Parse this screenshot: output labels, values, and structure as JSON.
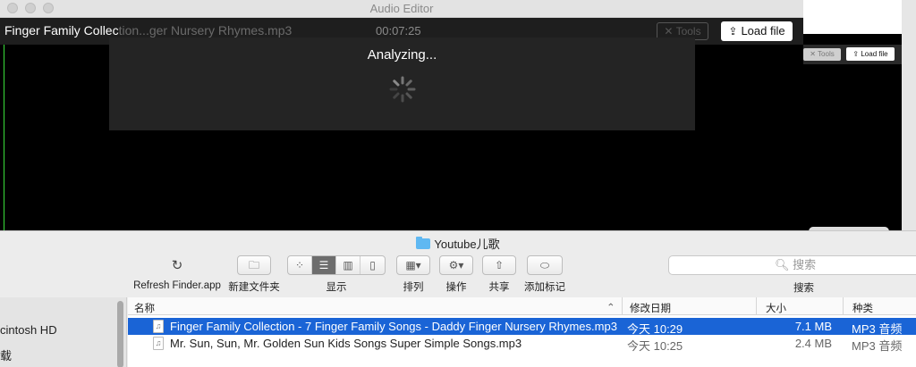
{
  "editor": {
    "window_title": "Audio Editor",
    "file_name_visible": "Finger Family Collec",
    "file_name_faded": "tion...ger Nursery Rhymes.mp3",
    "time": "00:07:25",
    "tools_label": "Tools",
    "load_label": "Load file",
    "analyzing_text": "Analyzing...",
    "playhead_color": "#3adf3a"
  },
  "back_window": {
    "tools_label": "Tools",
    "load_label": "Load file"
  },
  "finder": {
    "title": "Youtube儿歌",
    "toolbar": {
      "refresh_label": "Refresh Finder.app",
      "new_folder_label": "新建文件夹",
      "view_label": "显示",
      "arrange_label": "排列",
      "action_label": "操作",
      "share_label": "共享",
      "tag_label": "添加标记",
      "search_placeholder": "搜索",
      "search_label": "搜索"
    },
    "sidebar": {
      "items": [
        "cintosh HD",
        "载"
      ]
    },
    "columns": {
      "name": "名称",
      "date": "修改日期",
      "size": "大小",
      "kind": "种类"
    },
    "files": [
      {
        "name": "Finger Family Collection - 7 Finger Family Songs - Daddy Finger Nursery Rhymes.mp3",
        "date": "今天 10:29",
        "size": "7.1 MB",
        "kind": "MP3 音频",
        "selected": true
      },
      {
        "name": "Mr. Sun, Sun, Mr. Golden Sun Kids Songs Super Simple Songs.mp3",
        "date": "今天 10:25",
        "size": "2.4 MB",
        "kind": "MP3 音频",
        "selected": false
      }
    ]
  }
}
